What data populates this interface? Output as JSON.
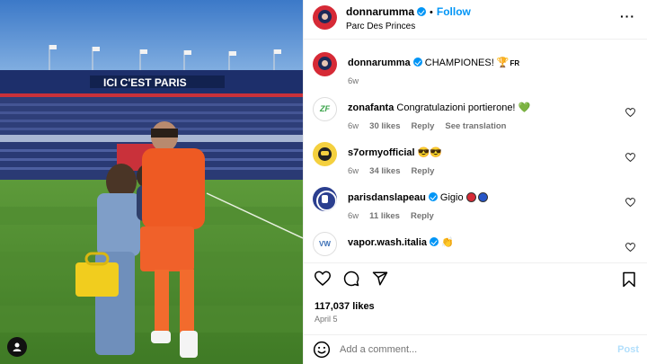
{
  "post": {
    "author": "donnarumma",
    "follow_label": "Follow",
    "separator": "•",
    "location": "Parc Des Princes",
    "stadium_banner": "ICI C'EST PARIS",
    "caption": {
      "username": "donnarumma",
      "text": "CHAMPIONES!",
      "emoji": "🏆",
      "flag_text": "FR",
      "age": "6w"
    },
    "likes": "117,037 likes",
    "date": "April 5"
  },
  "comments": [
    {
      "username": "zonafanta",
      "text": "Congratulazioni portierone!",
      "emoji": "💚",
      "age": "6w",
      "likes": "30 likes",
      "reply": "Reply",
      "translate": "See translation",
      "verified": false
    },
    {
      "username": "s7ormyofficial",
      "text": "",
      "emoji": "😎😎",
      "age": "6w",
      "likes": "34 likes",
      "reply": "Reply",
      "verified": false
    },
    {
      "username": "parisdanslapeau",
      "text": "Gigio",
      "age": "6w",
      "likes": "11 likes",
      "reply": "Reply",
      "verified": true,
      "colors": [
        "#d62a36",
        "#2756c7"
      ]
    },
    {
      "username": "vapor.wash.italia",
      "text": "",
      "emoji": "👏",
      "verified": true
    }
  ],
  "comment_box": {
    "placeholder": "Add a comment...",
    "post_label": "Post"
  },
  "icons": {
    "more": "more-options-icon",
    "heart": "heart-icon",
    "comment": "comment-icon",
    "share": "share-icon",
    "save": "bookmark-icon",
    "emoji": "emoji-icon",
    "user": "user-tag-icon"
  },
  "colors": {
    "accent": "#0095f6",
    "meta": "#737373",
    "post_disabled": "#b2dffc"
  }
}
